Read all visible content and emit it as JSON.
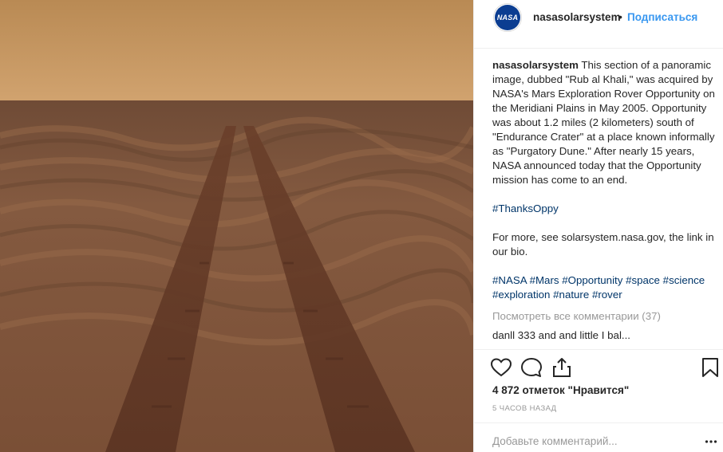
{
  "post": {
    "image_alt": "Mars dunes with rover tracks",
    "username": "nasasolarsystem",
    "follow_label": "Подписаться",
    "separator": "•",
    "avatar_text": "NASA"
  },
  "caption": {
    "username": "nasasolarsystem",
    "text": "This section of a panoramic image, dubbed \"Rub al Khali,\" was acquired by NASA's Mars Exploration Rover Opportunity on the Meridiani Plains in May 2005. Opportunity was about 1.2 miles (2 kilometers) south of \"Endurance Crater\" at a place known informally as \"Purgatory Dune.\" After nearly 15 years, NASA announced today that the Opportunity mission has come to an end.",
    "hashtag_line": "#ThanksOppy",
    "more_text": "For more, see solarsystem.nasa.gov, the link in our bio.",
    "tags": [
      "#NASA",
      "#Mars",
      "#Opportunity",
      "#space",
      "#science",
      "#exploration",
      "#nature",
      "#rover"
    ],
    "view_all": "Посмотреть все комментарии (37)",
    "partial_comment": "danll 333 and and little I bal..."
  },
  "actions": {
    "like_icon": "heart-icon",
    "comment_icon": "speech-bubble-icon",
    "share_icon": "share-icon",
    "save_icon": "bookmark-icon"
  },
  "likes": "4 872 отметок \"Нравится\"",
  "timestamp": "5 часов назад",
  "comment_placeholder": "Добавьте комментарий...",
  "colors": {
    "link": "#3897f0",
    "hashtag": "#003569",
    "muted": "#999999",
    "text": "#262626",
    "sky": "#c9985e",
    "ground": "#8a5a3c"
  }
}
